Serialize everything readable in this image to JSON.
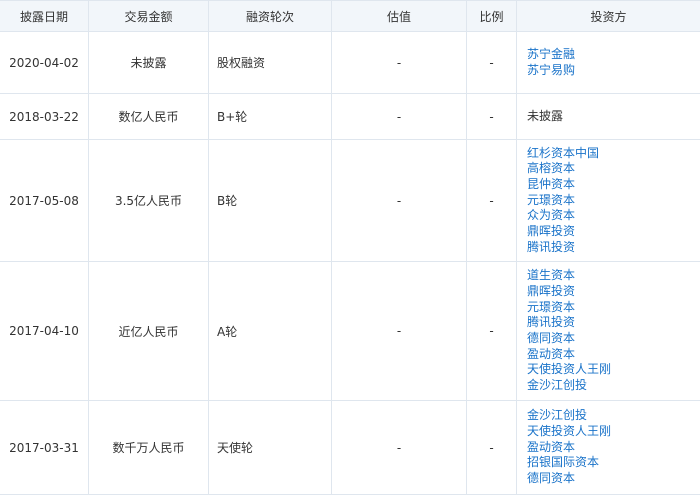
{
  "columns": [
    "披露日期",
    "交易金额",
    "融资轮次",
    "估值",
    "比例",
    "投资方"
  ],
  "rows": [
    {
      "date": "2020-04-02",
      "amount": "未披露",
      "round": "股权融资",
      "valuation": "-",
      "ratio": "-",
      "investors": [
        "苏宁金融",
        "苏宁易购"
      ],
      "investors_linked": true
    },
    {
      "date": "2018-03-22",
      "amount": "数亿人民币",
      "round": "B+轮",
      "valuation": "-",
      "ratio": "-",
      "investors": [
        "未披露"
      ],
      "investors_linked": false
    },
    {
      "date": "2017-05-08",
      "amount": "3.5亿人民币",
      "round": "B轮",
      "valuation": "-",
      "ratio": "-",
      "investors": [
        "红杉资本中国",
        "高榕资本",
        "昆仲资本",
        "元璟资本",
        "众为资本",
        "鼎晖投资",
        "腾讯投资"
      ],
      "investors_linked": true
    },
    {
      "date": "2017-04-10",
      "amount": "近亿人民币",
      "round": "A轮",
      "valuation": "-",
      "ratio": "-",
      "investors": [
        "道生资本",
        "鼎晖投资",
        "元璟资本",
        "腾讯投资",
        "德同资本",
        "盈动资本",
        "天使投资人王刚",
        "金沙江创投"
      ],
      "investors_linked": true
    },
    {
      "date": "2017-03-31",
      "amount": "数千万人民币",
      "round": "天使轮",
      "valuation": "-",
      "ratio": "-",
      "investors": [
        "金沙江创投",
        "天使投资人王刚",
        "盈动资本",
        "招银国际资本",
        "德同资本"
      ],
      "investors_linked": true
    }
  ],
  "colors": {
    "link": "#1a73c9",
    "header_bg": "#f2f6fa",
    "border": "#dfe6ee"
  }
}
